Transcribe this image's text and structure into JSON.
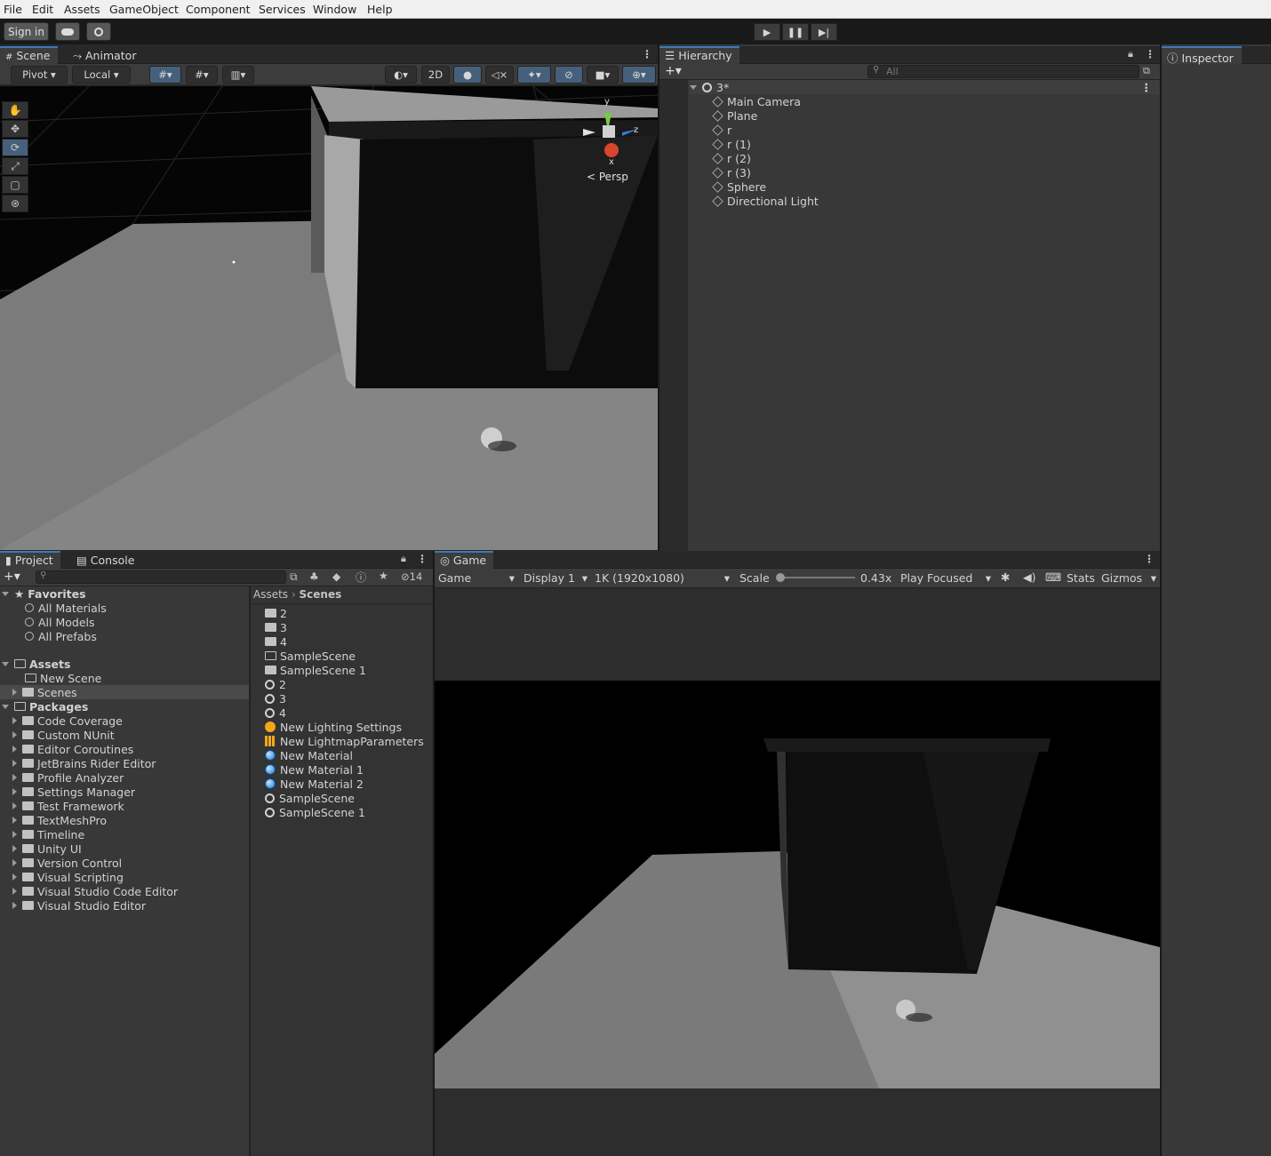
{
  "menu": [
    "File",
    "Edit",
    "Assets",
    "GameObject",
    "Component",
    "Services",
    "Window",
    "Help"
  ],
  "toolbar": {
    "sign_in": "Sign in"
  },
  "scene_panel": {
    "tabs": [
      "Scene",
      "Animator"
    ],
    "pivot": "Pivot",
    "local": "Local",
    "two_d": "2D",
    "persp": "Persp",
    "axes": {
      "y": "y",
      "z": "z",
      "x": "x"
    }
  },
  "hierarchy": {
    "tab": "Hierarchy",
    "search_placeholder": "All",
    "scene": "3*",
    "items": [
      "Main Camera",
      "Plane",
      "r",
      "r (1)",
      "r (2)",
      "r (3)",
      "Sphere",
      "Directional Light"
    ]
  },
  "inspector": {
    "tab": "Inspector"
  },
  "project": {
    "tabs": [
      "Project",
      "Console"
    ],
    "hidden_count": "14",
    "favorites_label": "Favorites",
    "favorites": [
      "All Materials",
      "All Models",
      "All Prefabs"
    ],
    "assets_label": "Assets",
    "assets": [
      "New Scene",
      "Scenes"
    ],
    "packages_label": "Packages",
    "packages": [
      "Code Coverage",
      "Custom NUnit",
      "Editor Coroutines",
      "JetBrains Rider Editor",
      "Profile Analyzer",
      "Settings Manager",
      "Test Framework",
      "TextMeshPro",
      "Timeline",
      "Unity UI",
      "Version Control",
      "Visual Scripting",
      "Visual Studio Code Editor",
      "Visual Studio Editor"
    ],
    "breadcrumb": [
      "Assets",
      "Scenes"
    ],
    "files": [
      {
        "name": "2",
        "icon": "folder-icon"
      },
      {
        "name": "3",
        "icon": "folder-icon"
      },
      {
        "name": "4",
        "icon": "folder-icon"
      },
      {
        "name": "SampleScene",
        "icon": "folder-empty-icon"
      },
      {
        "name": "SampleScene 1",
        "icon": "folder-icon"
      },
      {
        "name": "2",
        "icon": "unity-scene-icon"
      },
      {
        "name": "3",
        "icon": "unity-scene-icon"
      },
      {
        "name": "4",
        "icon": "unity-scene-icon"
      },
      {
        "name": "New Lighting Settings",
        "icon": "lighting-settings-icon"
      },
      {
        "name": "New LightmapParameters",
        "icon": "lightmap-params-icon"
      },
      {
        "name": "New Material",
        "icon": "material-icon"
      },
      {
        "name": "New Material 1",
        "icon": "material-icon"
      },
      {
        "name": "New Material 2",
        "icon": "material-icon"
      },
      {
        "name": "SampleScene",
        "icon": "unity-scene-icon"
      },
      {
        "name": "SampleScene 1",
        "icon": "unity-scene-icon"
      }
    ]
  },
  "game": {
    "tab": "Game",
    "view": "Game",
    "display": "Display 1",
    "resolution": "1K (1920x1080)",
    "scale_label": "Scale",
    "scale_value": "0.43x",
    "scale_fraction": 0.05,
    "play_mode": "Play Focused",
    "stats": "Stats",
    "gizmos": "Gizmos"
  }
}
